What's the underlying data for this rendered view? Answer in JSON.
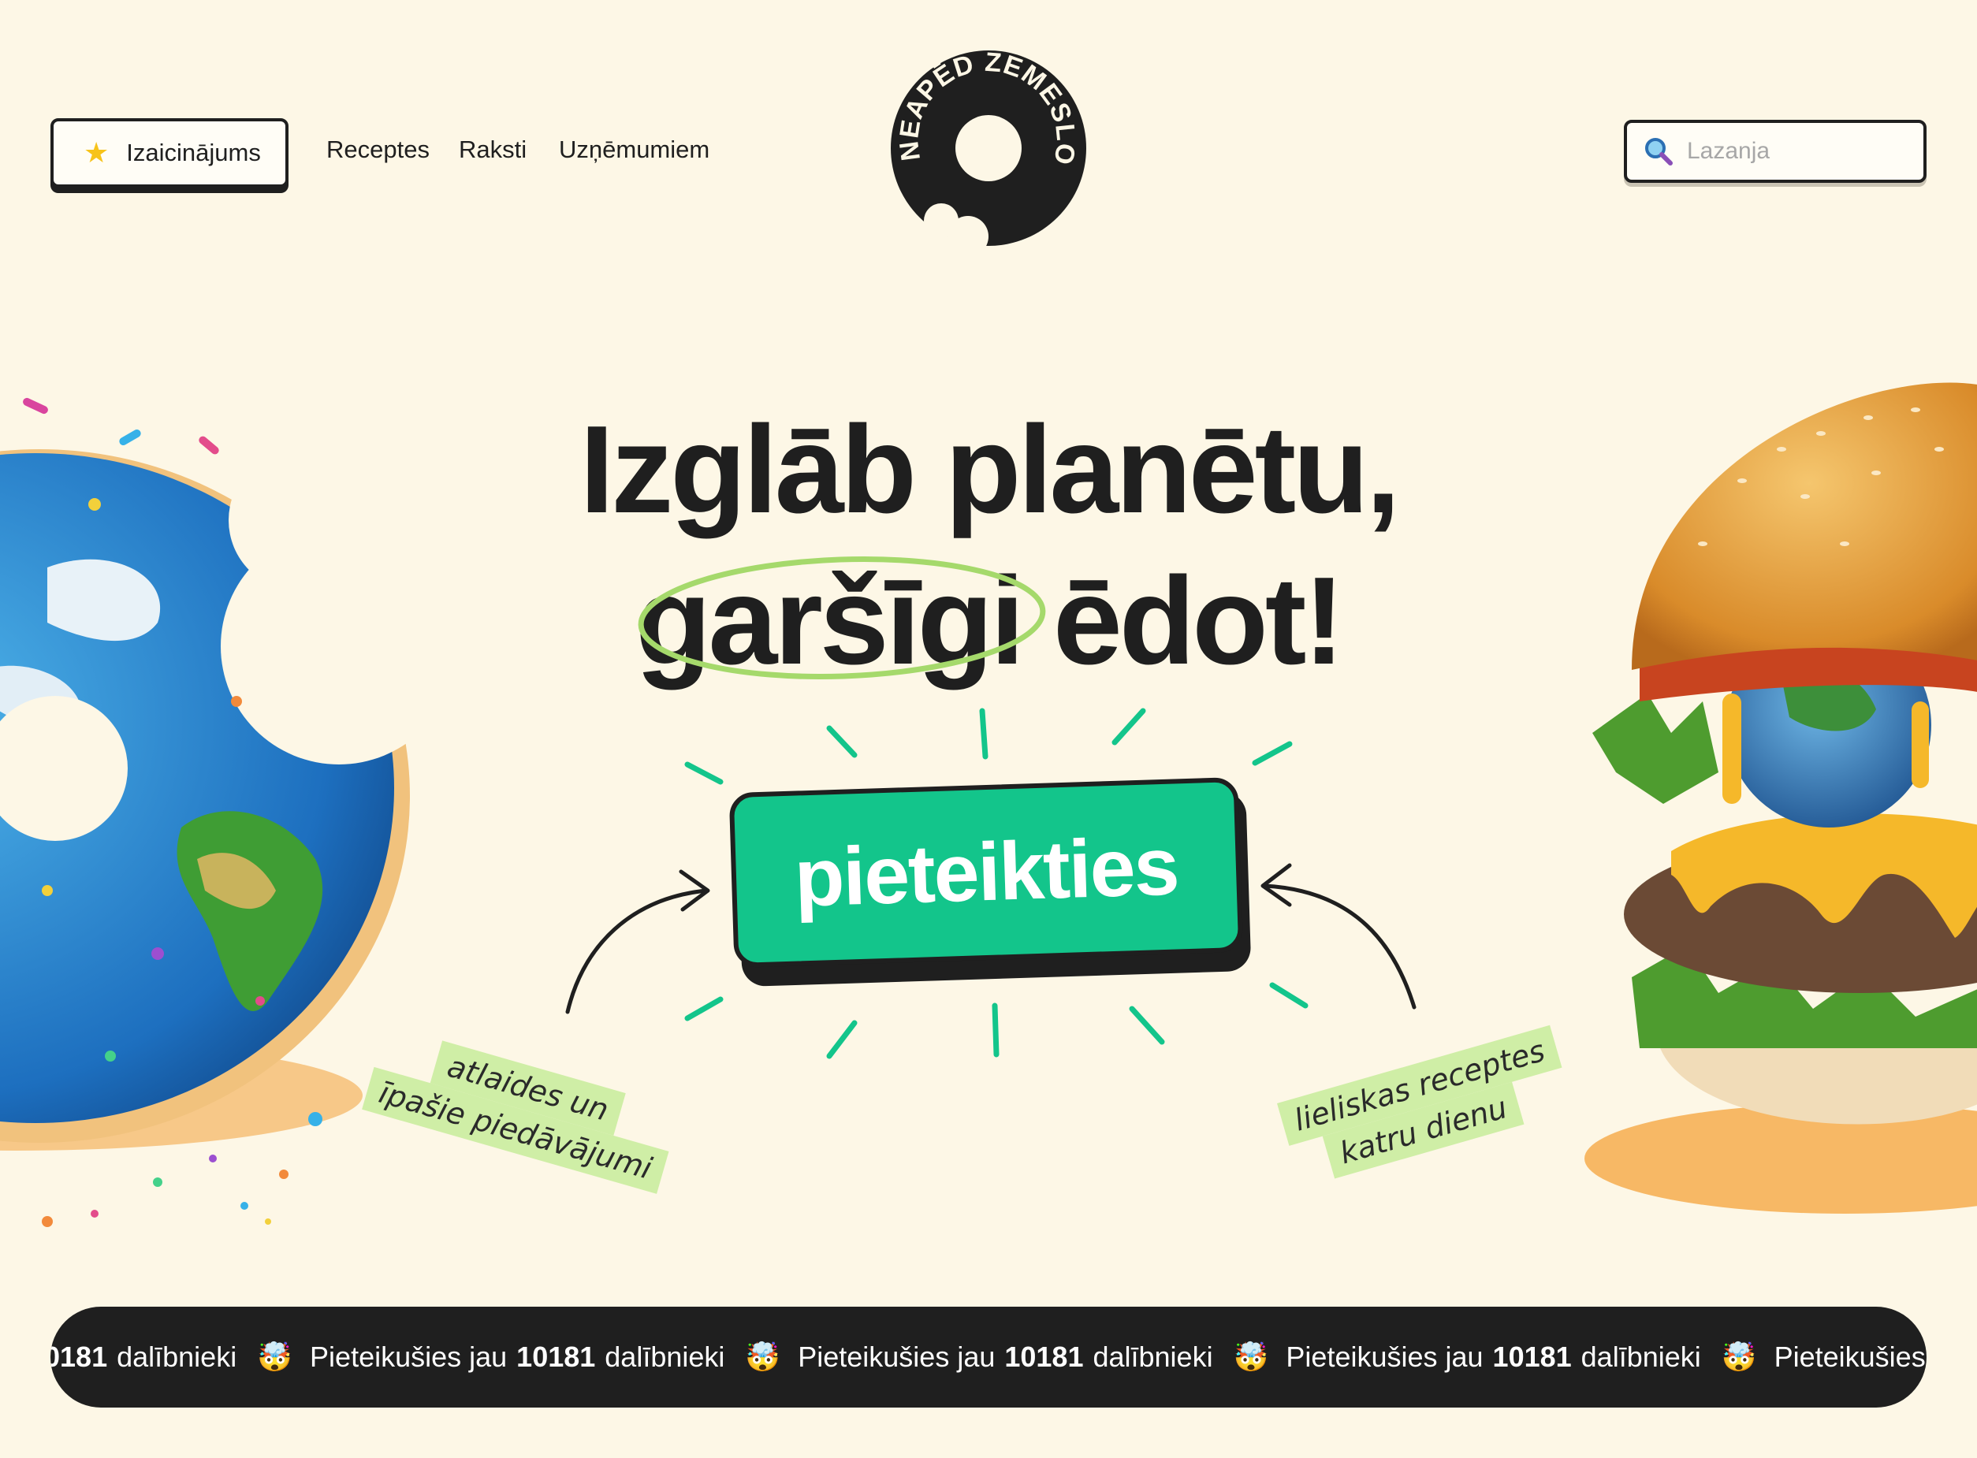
{
  "header": {
    "challenge_label": "Izaicinājums",
    "nav": [
      {
        "label": "Receptes"
      },
      {
        "label": "Raksti"
      },
      {
        "label": "Uzņēmumiem"
      }
    ],
    "logo_text": "NEAPĒD ZEMESLODI!",
    "search": {
      "placeholder": "Lazanja",
      "value": ""
    }
  },
  "hero": {
    "title_line1": "Izglāb planētu,",
    "title_highlight": "garšīgi",
    "title_rest": " ēdot!",
    "cta_label": "pieteikties",
    "tag_left": {
      "line1": "atlaides un",
      "line2": "īpašie piedāvājumi"
    },
    "tag_right": {
      "line1": "lieliskas receptes",
      "line2": "katru dienu"
    }
  },
  "ticker": {
    "prefix": "Pieteikušies jau",
    "count": "10181",
    "suffix": "dalībnieki",
    "partial_count": "0181",
    "emoji": "🤯"
  },
  "colors": {
    "background": "#fdf7e6",
    "accent_green": "#13c58b",
    "highlight_green": "#9fd76a",
    "tag_green": "#cfeea6",
    "dark": "#1f1f1f",
    "star": "#f7c31a"
  },
  "icons": [
    "star-icon",
    "search-icon",
    "earth-donut-image",
    "earth-burger-image",
    "arrow-icon"
  ]
}
